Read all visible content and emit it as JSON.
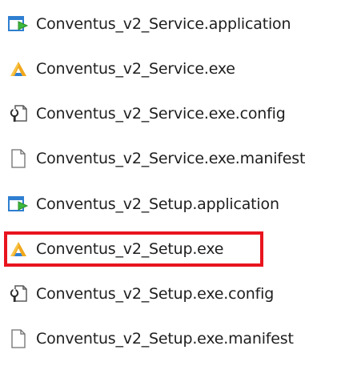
{
  "window": {
    "title": ""
  },
  "files": [
    {
      "name": "Conventus_v2_Service.application",
      "icon": "application-manifest-icon"
    },
    {
      "name": "Conventus_v2_Service.exe",
      "icon": "executable-icon"
    },
    {
      "name": "Conventus_v2_Service.exe.config",
      "icon": "config-file-icon"
    },
    {
      "name": "Conventus_v2_Service.exe.manifest",
      "icon": "blank-file-icon"
    },
    {
      "name": "Conventus_v2_Setup.application",
      "icon": "application-manifest-icon"
    },
    {
      "name": "Conventus_v2_Setup.exe",
      "icon": "executable-icon",
      "highlighted": true
    },
    {
      "name": "Conventus_v2_Setup.exe.config",
      "icon": "config-file-icon"
    },
    {
      "name": "Conventus_v2_Setup.exe.manifest",
      "icon": "blank-file-icon"
    }
  ],
  "colors": {
    "text": "#1e1e1e",
    "highlight": "#e8141e",
    "application_icon": "#2f7fd1",
    "exe_icon": "#f0a81c"
  }
}
